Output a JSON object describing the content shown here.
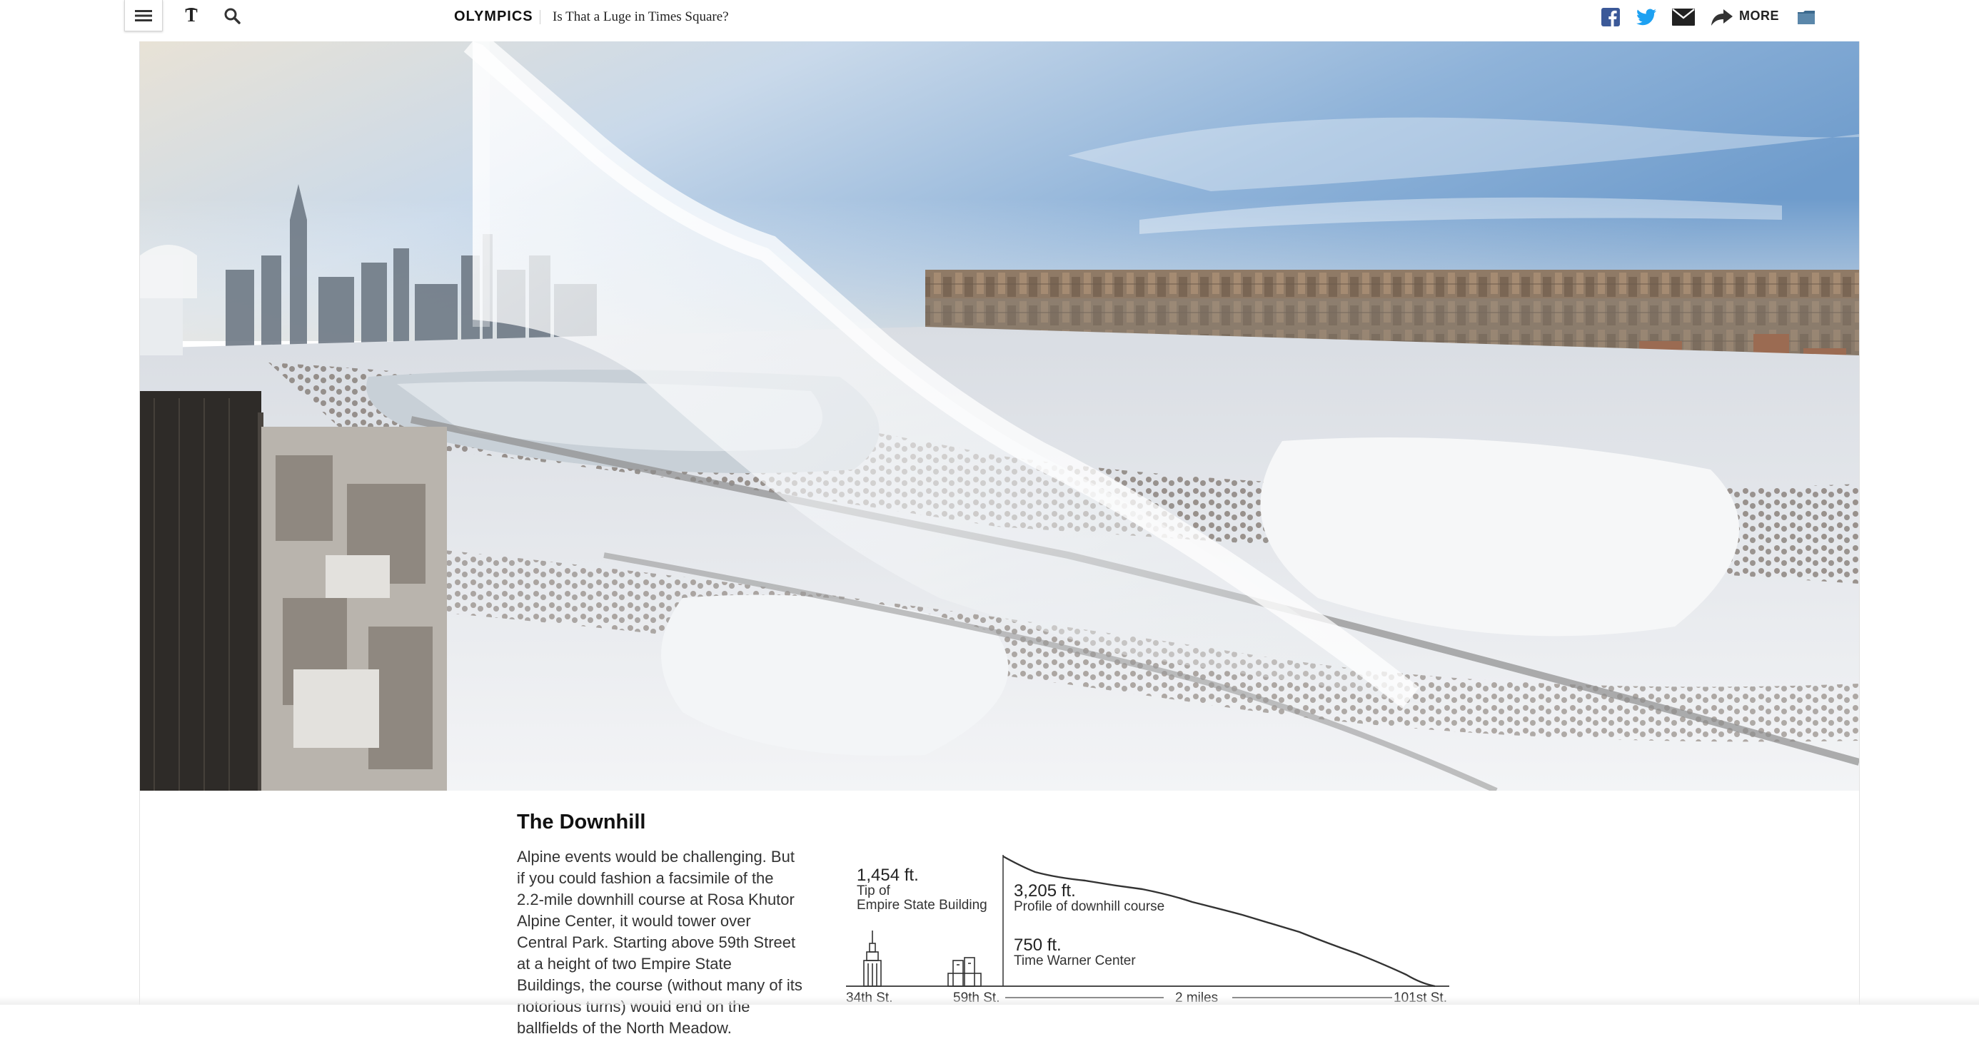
{
  "toolbar": {
    "menu_icon": "hamburger-menu-icon",
    "logo_icon": "nyt-logo-icon",
    "search_icon": "search-icon",
    "section": "OLYMPICS",
    "headline": "Is That a Luge in Times Square?",
    "share": {
      "facebook_icon": "facebook-icon",
      "twitter_icon": "twitter-icon",
      "email_icon": "email-icon",
      "more_icon": "share-arrow-icon",
      "more_label": "MORE",
      "save_icon": "save-folder-icon"
    },
    "colors": {
      "facebook": "#3b5998",
      "twitter": "#1da1f2"
    }
  },
  "hero": {
    "description_icon": "central-park-aerial-photo"
  },
  "article": {
    "heading": "The Downhill",
    "body": "Alpine events would be challenging. But if you could fashion a facsimile of the 2.2-mile downhill course at Rosa Khutor Alpine Center, it would tower over Central Park. Starting above 59th Street at a height of two Empire State Buildings, the course (without many of its notorious turns) would end on the ballfields of the North Meadow."
  },
  "profile_chart": {
    "labels": {
      "empire_value": "1,454 ft.",
      "empire_line1": "Tip of",
      "empire_line2": "Empire State Building",
      "course_value": "3,205 ft.",
      "course_label": "Profile of downhill course",
      "twc_value": "750 ft.",
      "twc_label": "Time Warner Center",
      "street_34": "34th St.",
      "street_59": "59th St.",
      "distance": "2 miles",
      "street_101": "101st St."
    }
  }
}
